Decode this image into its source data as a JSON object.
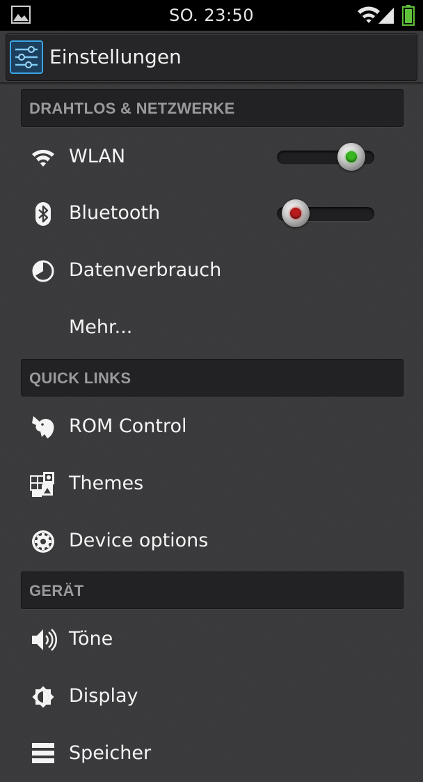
{
  "status_bar": {
    "time": "SO. 23:50",
    "icons": [
      "gallery-icon",
      "wifi-icon",
      "signal-icon",
      "battery-icon"
    ],
    "battery_color": "#5fc23a"
  },
  "action_bar": {
    "title": "Einstellungen",
    "icon": "settings-sliders-icon",
    "icon_color": "#3aa6e6"
  },
  "sections": {
    "wireless": "DRAHTLOS & NETZWERKE",
    "quick_links": "QUICK LINKS",
    "device": "GERÄT"
  },
  "items": {
    "wlan": {
      "label": "WLAN",
      "icon": "wifi-icon",
      "toggle": "on",
      "led_color": "#39b822"
    },
    "bluetooth": {
      "label": "Bluetooth",
      "icon": "bluetooth-icon",
      "toggle": "off",
      "led_color": "#b81c1c"
    },
    "data_usage": {
      "label": "Datenverbrauch",
      "icon": "data-usage-icon"
    },
    "more": {
      "label": "Mehr..."
    },
    "rom_control": {
      "label": "ROM Control",
      "icon": "unicorn-icon"
    },
    "themes": {
      "label": "Themes",
      "icon": "themes-icon"
    },
    "device_options": {
      "label": "Device options",
      "icon": "gear-icon"
    },
    "sounds": {
      "label": "Töne",
      "icon": "speaker-icon"
    },
    "display": {
      "label": "Display",
      "icon": "brightness-icon"
    },
    "storage": {
      "label": "Speicher",
      "icon": "storage-icon"
    }
  }
}
